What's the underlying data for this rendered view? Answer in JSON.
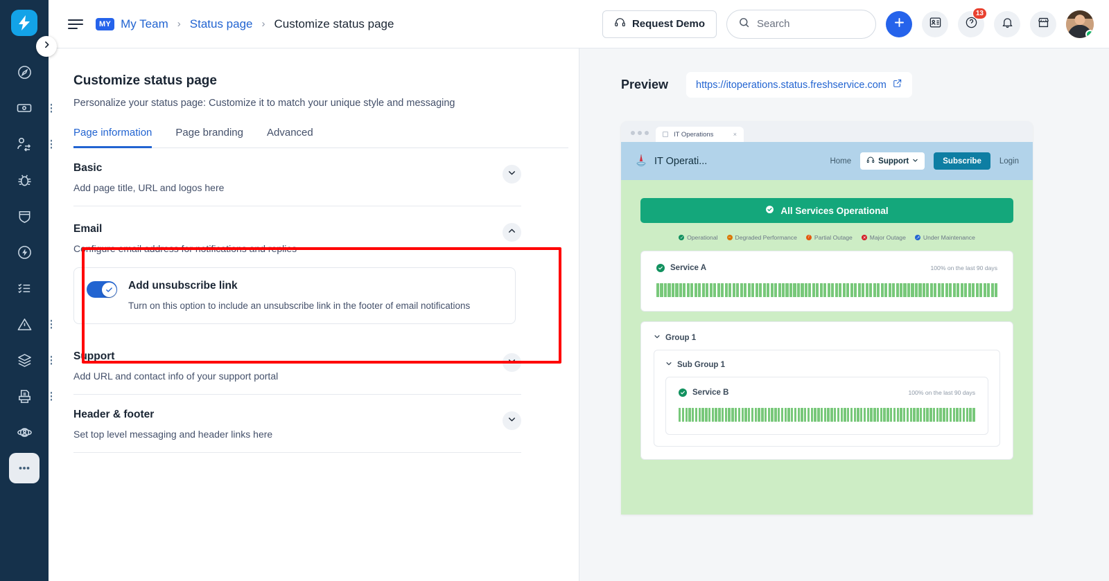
{
  "rail": {
    "logo_icon": "freshservice-bolt-logo",
    "items": [
      {
        "icon": "dashboard-gauge-icon",
        "name": "dashboard",
        "menu": false,
        "active": false
      },
      {
        "icon": "ticket-icon",
        "name": "tickets",
        "menu": true,
        "active": false
      },
      {
        "icon": "user-swap-icon",
        "name": "changes",
        "menu": true,
        "active": false
      },
      {
        "icon": "bug-icon",
        "name": "problems",
        "menu": false,
        "active": false
      },
      {
        "icon": "shield-icon",
        "name": "releases",
        "menu": false,
        "active": false
      },
      {
        "icon": "flash-circle-icon",
        "name": "automation",
        "menu": false,
        "active": false
      },
      {
        "icon": "checklist-icon",
        "name": "tasks",
        "menu": false,
        "active": false
      },
      {
        "icon": "alert-triangle-icon",
        "name": "alerts",
        "menu": true,
        "active": false
      },
      {
        "icon": "layers-icon",
        "name": "assets",
        "menu": true,
        "active": false
      },
      {
        "icon": "report-printer-icon",
        "name": "reports",
        "menu": true,
        "active": false
      },
      {
        "icon": "orbit-user-icon",
        "name": "workspaces",
        "menu": false,
        "active": false
      },
      {
        "icon": "ellipsis-icon",
        "name": "more",
        "menu": false,
        "active": true
      }
    ],
    "expand_icon": "chevron-right-icon"
  },
  "topbar": {
    "menu_icon": "hamburger-icon",
    "breadcrumb": {
      "badge": "MY",
      "team": "My Team",
      "separator": "›",
      "section": "Status page",
      "current": "Customize status page"
    },
    "request_demo": {
      "label": "Request Demo",
      "icon": "headset-icon"
    },
    "search": {
      "placeholder": "Search",
      "value": "",
      "icon": "search-icon"
    },
    "add_button_icon": "plus-icon",
    "icons": [
      {
        "name": "contacts-card-icon",
        "badge": ""
      },
      {
        "name": "help-question-icon",
        "badge": "13"
      },
      {
        "name": "bell-notification-icon",
        "badge": ""
      },
      {
        "name": "marketplace-store-icon",
        "badge": ""
      }
    ],
    "avatar": {
      "name": "user-avatar",
      "status": "online"
    }
  },
  "editor": {
    "title": "Customize status page",
    "subtitle": "Personalize your status page: Customize it to match your unique style and messaging",
    "tabs": [
      {
        "label": "Page information",
        "active": true
      },
      {
        "label": "Page branding",
        "active": false
      },
      {
        "label": "Advanced",
        "active": false
      }
    ],
    "sections": [
      {
        "title": "Basic",
        "desc": "Add page title, URL and logos here",
        "expanded": false,
        "chevron": "chevron-down-icon"
      },
      {
        "title": "Email",
        "desc": "Configure email address for notifications and replies",
        "expanded": true,
        "chevron": "chevron-up-icon"
      },
      {
        "title": "Support",
        "desc": "Add URL and contact info of your support portal",
        "expanded": false,
        "chevron": "chevron-down-icon"
      },
      {
        "title": "Header & footer",
        "desc": "Set top level messaging and header links here",
        "expanded": false,
        "chevron": "chevron-down-icon"
      }
    ],
    "unsubscribe": {
      "title": "Add unsubscribe link",
      "desc": "Turn on this option to include an unsubscribe link in the footer of email notifications",
      "enabled": true
    },
    "highlight_color": "#ff0000"
  },
  "preview": {
    "title": "Preview",
    "url": "https://itoperations.status.freshservice.com",
    "url_icon": "external-link-icon",
    "browser": {
      "tab_title": "IT Operations",
      "tab_close": "×"
    },
    "status_page": {
      "brand": "IT Operati...",
      "nav": [
        {
          "label": "Home",
          "type": "link"
        },
        {
          "label": "Support",
          "type": "dropdown",
          "icon": "headset-icon"
        },
        {
          "label": "Subscribe",
          "type": "primary"
        },
        {
          "label": "Login",
          "type": "link"
        }
      ],
      "banner": {
        "label": "All Services Operational",
        "icon": "check-circle-icon",
        "color": "#14a77b"
      },
      "legend": [
        {
          "label": "Operational",
          "color": "#12915f",
          "glyph": "✓"
        },
        {
          "label": "Degraded Performance",
          "color": "#d97706",
          "glyph": "–"
        },
        {
          "label": "Partial Outage",
          "color": "#e2590f",
          "glyph": "!"
        },
        {
          "label": "Major Outage",
          "color": "#d32029",
          "glyph": "✕"
        },
        {
          "label": "Under Maintenance",
          "color": "#2264d1",
          "glyph": "↗"
        }
      ],
      "services": [
        {
          "name": "Service A",
          "uptime": "100% on the last 90 days",
          "status": "operational"
        }
      ],
      "groups": [
        {
          "name": "Group 1",
          "chevron": "chevron-down-icon",
          "subgroups": [
            {
              "name": "Sub Group 1",
              "chevron": "chevron-down-icon",
              "services": [
                {
                  "name": "Service B",
                  "uptime": "100% on the last 90 days",
                  "status": "operational"
                }
              ]
            }
          ]
        }
      ]
    }
  }
}
